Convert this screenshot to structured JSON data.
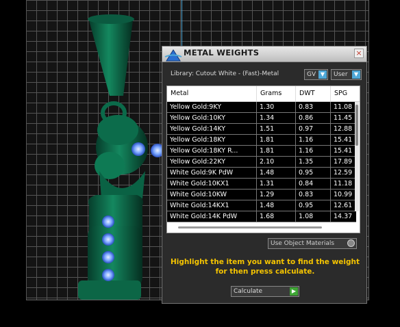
{
  "dialog": {
    "title": "METAL WEIGHTS",
    "close_label": "×",
    "library_label": "Library: Cutout White - (Fast)-Metal",
    "gv_dropdown": "GV",
    "user_dropdown": "User",
    "use_object_materials": "Use Object Materials",
    "hint_line1": "Highlight the item you want to find the weight",
    "hint_line2": "for then press calculate.",
    "calculate_dropdown": "Calculate"
  },
  "table": {
    "columns": [
      "Metal",
      "Grams",
      "DWT",
      "SPG"
    ],
    "rows": [
      [
        "Yellow Gold:9KY",
        "1.30",
        "0.83",
        "11.08"
      ],
      [
        "Yellow Gold:10KY",
        "1.34",
        "0.86",
        "11.45"
      ],
      [
        "Yellow Gold:14KY",
        "1.51",
        "0.97",
        "12.88"
      ],
      [
        "Yellow Gold:18KY",
        "1.81",
        "1.16",
        "15.41"
      ],
      [
        "Yellow Gold:18KY R...",
        "1.81",
        "1.16",
        "15.41"
      ],
      [
        "Yellow Gold:22KY",
        "2.10",
        "1.35",
        "17.89"
      ],
      [
        "White Gold:9K PdW",
        "1.48",
        "0.95",
        "12.59"
      ],
      [
        "White Gold:10KX1",
        "1.31",
        "0.84",
        "11.18"
      ],
      [
        "White Gold:10KW",
        "1.29",
        "0.83",
        "10.99"
      ],
      [
        "White Gold:14KX1",
        "1.48",
        "0.95",
        "12.61"
      ],
      [
        "White Gold:14K PdW",
        "1.68",
        "1.08",
        "14.37"
      ]
    ]
  },
  "colors": {
    "accent": "#4fa8d8",
    "hint": "#f5c400",
    "model": "#0e6b4e",
    "gem": "#7aa6ff"
  },
  "icons": {
    "app": "app-logo-icon",
    "close": "close-icon",
    "dropdown": "chevron-down-icon",
    "go": "play-icon"
  }
}
